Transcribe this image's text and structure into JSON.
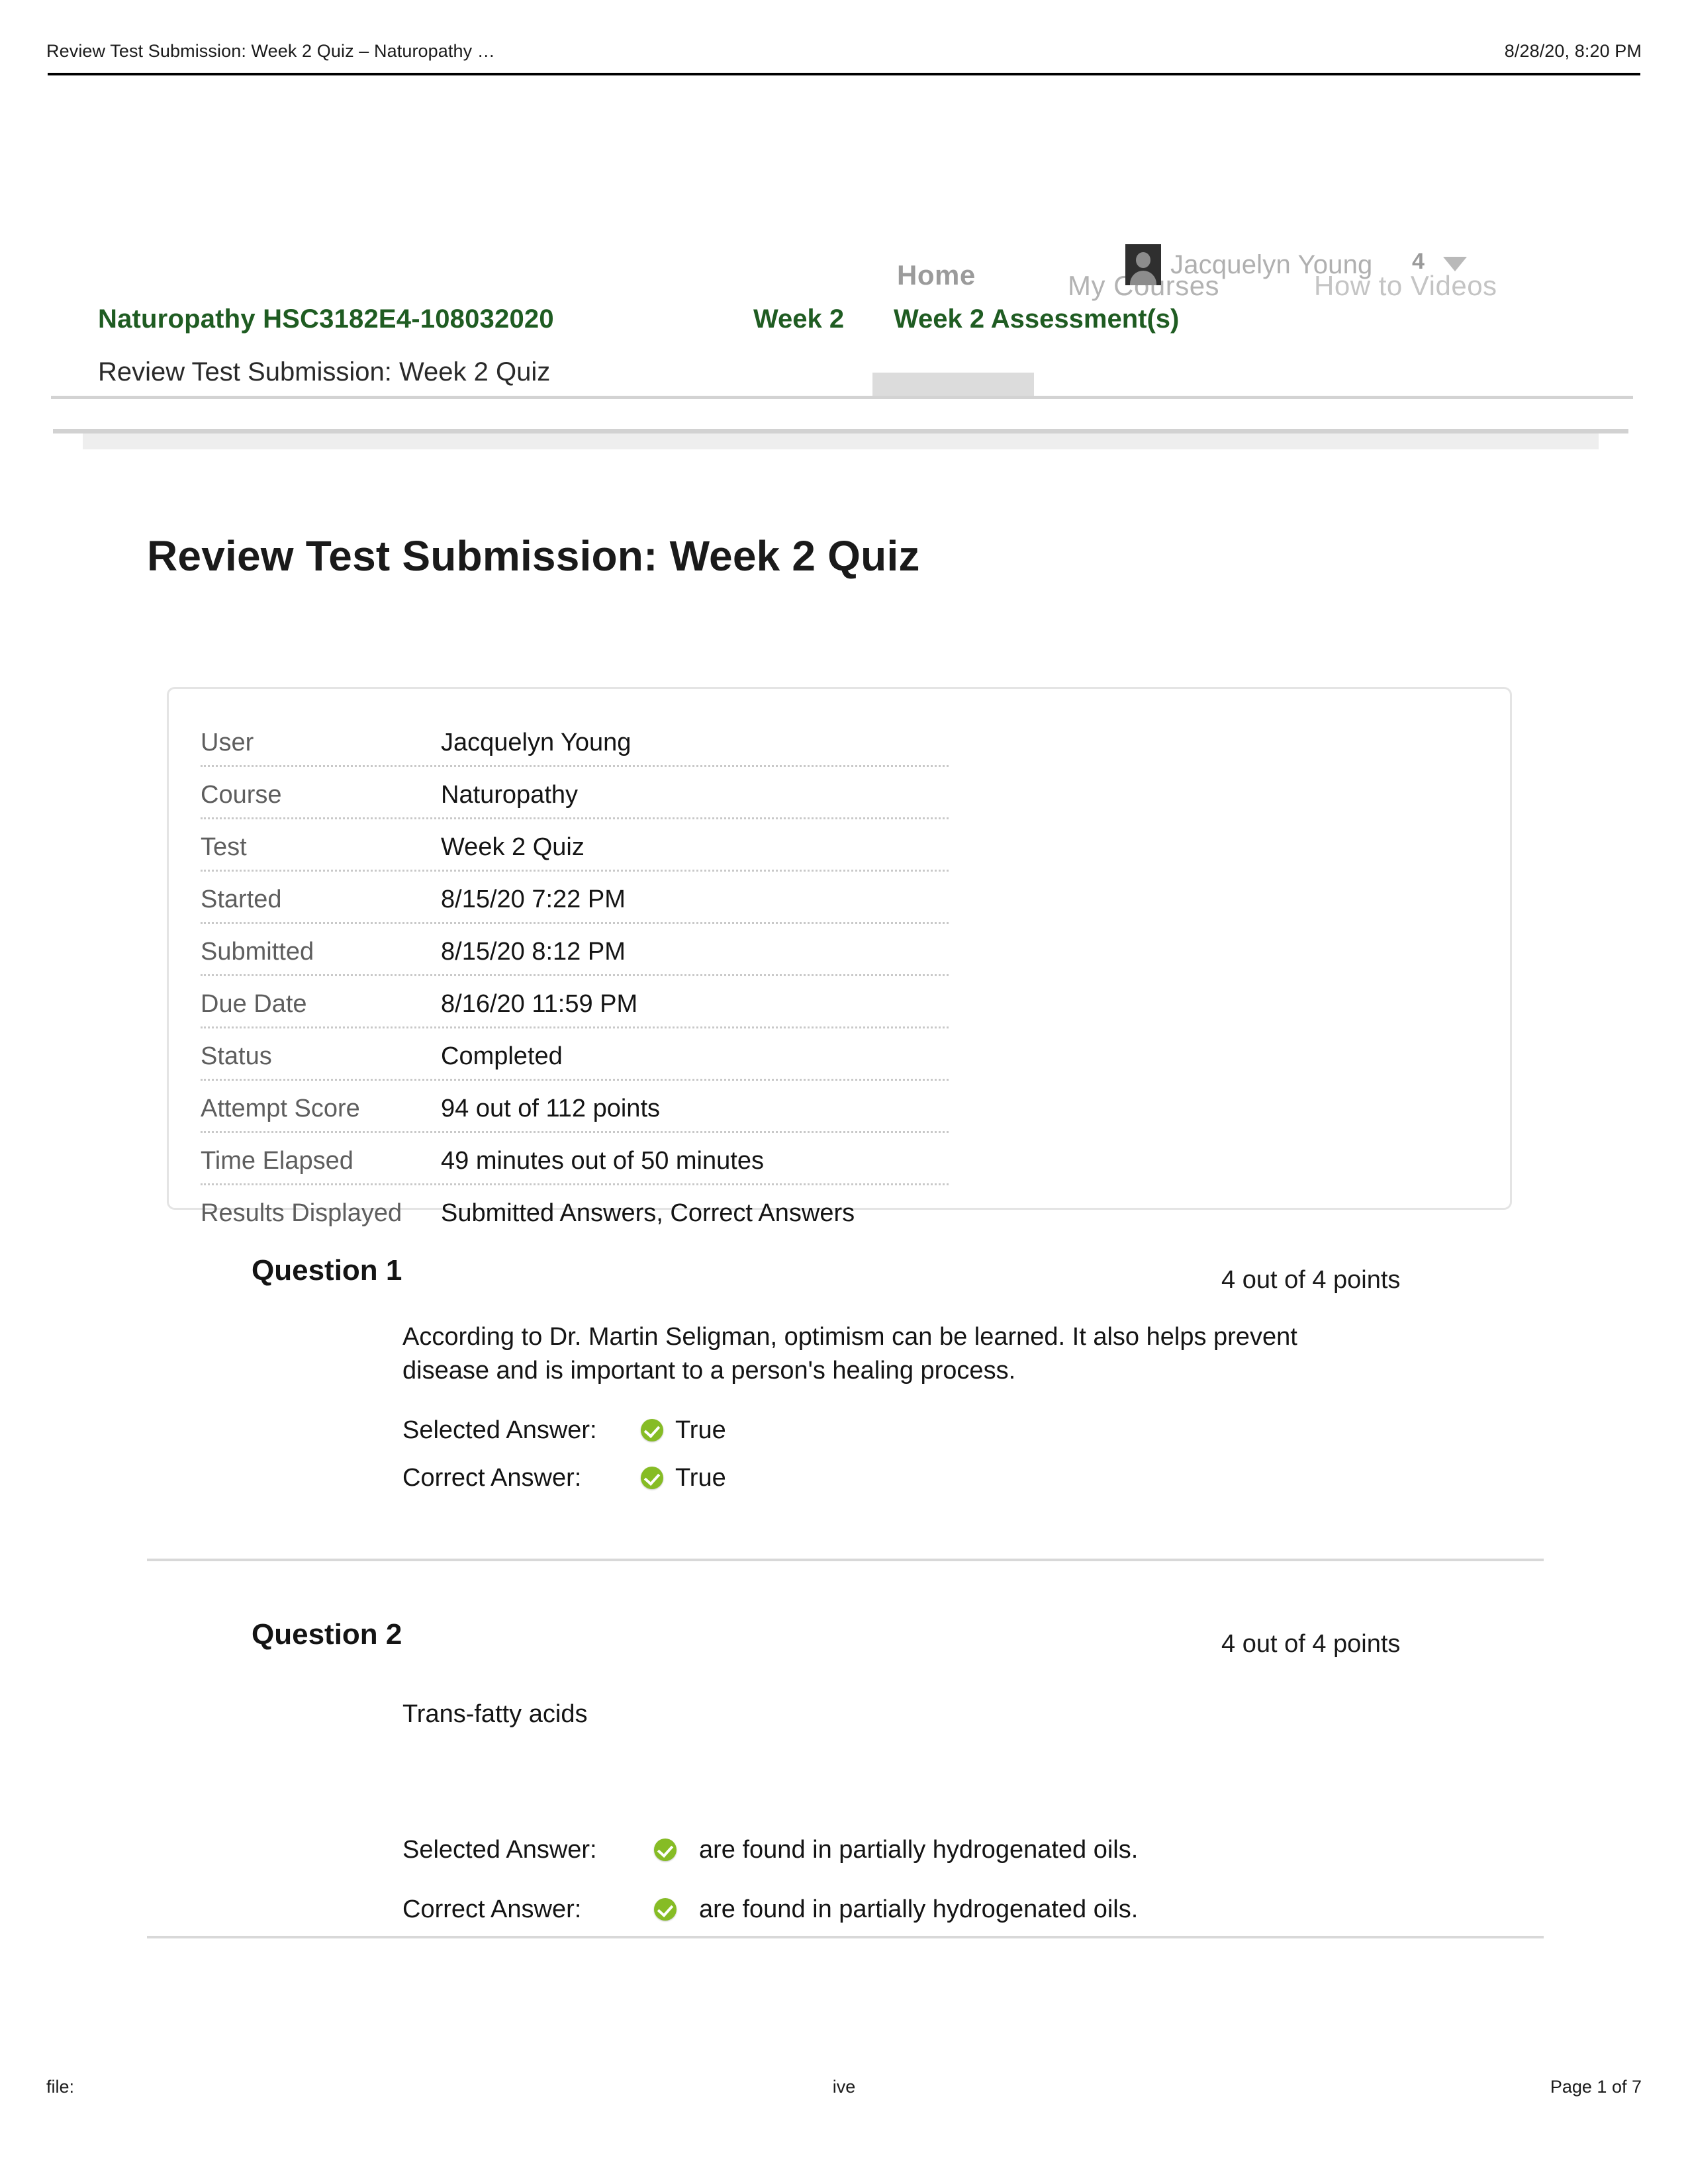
{
  "print_header": {
    "title": "Review Test Submission: Week 2 Quiz – Naturopathy …",
    "timestamp": "8/28/20, 8:20 PM"
  },
  "nav": {
    "home_label": "Home",
    "my_courses_label": "My Courses",
    "how_to_videos_label": "How to Videos",
    "user_name": "Jacquelyn Young",
    "notification_count": "4",
    "avatar_icon": "user-avatar-icon",
    "caret_icon": "chevron-down-icon"
  },
  "breadcrumb": {
    "course": "Naturopathy HSC3182E4-108032020",
    "week": "Week 2",
    "assessments": "Week 2 Assessment(s)",
    "current": "Review Test Submission: Week 2 Quiz",
    "link_color": "#1f5c22"
  },
  "page": {
    "title": "Review Test Submission: Week 2 Quiz"
  },
  "details": {
    "rows": [
      {
        "label": "User",
        "value": "Jacquelyn Young"
      },
      {
        "label": "Course",
        "value": "Naturopathy"
      },
      {
        "label": "Test",
        "value": "Week 2 Quiz"
      },
      {
        "label": "Started",
        "value": "8/15/20 7:22 PM"
      },
      {
        "label": "Submitted",
        "value": "8/15/20 8:12 PM"
      },
      {
        "label": "Due Date",
        "value": "8/16/20 11:59 PM"
      },
      {
        "label": "Status",
        "value": "Completed"
      },
      {
        "label": "Attempt Score",
        "value": "94 out of 112 points"
      },
      {
        "label": "Time Elapsed",
        "value": "49 minutes out of 50 minutes"
      },
      {
        "label": "Results Displayed",
        "value": "Submitted Answers, Correct Answers"
      }
    ]
  },
  "questions": [
    {
      "title": "Question 1",
      "points": "4 out of 4 points",
      "text": "According to Dr. Martin Seligman, optimism can be learned. It also helps prevent disease and is important to a person's healing process.",
      "selected_label": "Selected Answer:",
      "selected_value": "True",
      "selected_icon": "correct-check-icon",
      "correct_label": "Correct Answer:",
      "correct_value": "True",
      "correct_icon": "correct-check-icon"
    },
    {
      "title": "Question 2",
      "points": "4 out of 4 points",
      "text": "Trans-fatty acids",
      "selected_label": "Selected Answer:",
      "selected_value": "are found in partially hydrogenated oils.",
      "selected_icon": "correct-check-icon",
      "correct_label": "Correct Answer:",
      "correct_value": "are found in partially hydrogenated oils.",
      "correct_icon": "correct-check-icon"
    }
  ],
  "print_footer": {
    "left": "file:",
    "center": "ive",
    "right": "Page 1 of 7"
  },
  "colors": {
    "correct_green": "#86bc25",
    "breadcrumb_green": "#1f5c22",
    "rule_gray": "#d3d3d3"
  }
}
